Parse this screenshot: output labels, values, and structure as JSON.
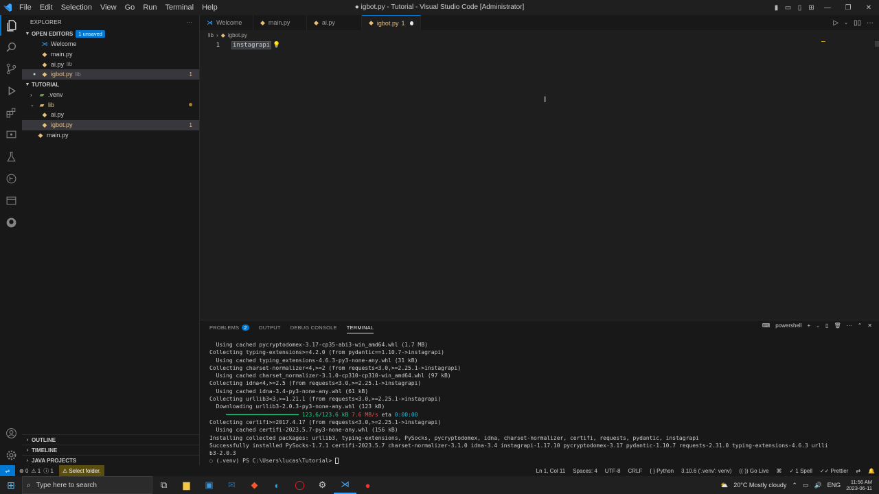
{
  "window": {
    "title": "● igbot.py - Tutorial - Visual Studio Code [Administrator]"
  },
  "menu": [
    "File",
    "Edit",
    "Selection",
    "View",
    "Go",
    "Run",
    "Terminal",
    "Help"
  ],
  "sidebar": {
    "title": "EXPLORER",
    "open_editors": {
      "label": "OPEN EDITORS",
      "badge": "1 unsaved",
      "items": [
        {
          "name": "Welcome",
          "hint": ""
        },
        {
          "name": "main.py",
          "hint": ""
        },
        {
          "name": "ai.py",
          "hint": "lib"
        },
        {
          "name": "igbot.py",
          "hint": "lib",
          "count": "1"
        }
      ]
    },
    "folder": {
      "label": "TUTORIAL",
      "items": [
        {
          "name": ".venv"
        },
        {
          "name": "lib"
        },
        {
          "name": "ai.py"
        },
        {
          "name": "igbot.py",
          "count": "1"
        },
        {
          "name": "main.py"
        }
      ]
    },
    "bottom": [
      "OUTLINE",
      "TIMELINE",
      "JAVA PROJECTS"
    ]
  },
  "tabs": [
    {
      "label": "Welcome"
    },
    {
      "label": "main.py"
    },
    {
      "label": "ai.py"
    },
    {
      "label": "igbot.py",
      "count": "1"
    }
  ],
  "breadcrumb": [
    "lib",
    "igbot.py"
  ],
  "editor": {
    "line_number": "1",
    "code": "instagrapi"
  },
  "panel": {
    "tabs": [
      "PROBLEMS",
      "OUTPUT",
      "DEBUG CONSOLE",
      "TERMINAL"
    ],
    "problems_count": "2",
    "shell": "powershell",
    "terminal_lines": [
      "  Using cached pycryptodomex-3.17-cp35-abi3-win_amd64.whl (1.7 MB)",
      "Collecting typing-extensions>=4.2.0 (from pydantic==1.10.7->instagrapi)",
      "  Using cached typing_extensions-4.6.3-py3-none-any.whl (31 kB)",
      "Collecting charset-normalizer<4,>=2 (from requests<3.0,>=2.25.1->instagrapi)",
      "  Using cached charset_normalizer-3.1.0-cp310-cp310-win_amd64.whl (97 kB)",
      "Collecting idna<4,>=2.5 (from requests<3.0,>=2.25.1->instagrapi)",
      "  Using cached idna-3.4-py3-none-any.whl (61 kB)",
      "Collecting urllib3<3,>=1.21.1 (from requests<3.0,>=2.25.1->instagrapi)",
      "  Downloading urllib3-2.0.3-py3-none-any.whl (123 kB)"
    ],
    "progress": {
      "bar": "     ━━━━━━━━━━━━━━━━━━━━━━ ",
      "size": "123.6/123.6 kB",
      "speed": "7.6 MB/s",
      "eta_label": "eta",
      "eta": "0:00:00"
    },
    "terminal_lines_after": [
      "Collecting certifi>=2017.4.17 (from requests<3.0,>=2.25.1->instagrapi)",
      "  Using cached certifi-2023.5.7-py3-none-any.whl (156 kB)",
      "Installing collected packages: urllib3, typing-extensions, PySocks, pycryptodomex, idna, charset-normalizer, certifi, requests, pydantic, instagrapi",
      "Successfully installed PySocks-1.7.1 certifi-2023.5.7 charset-normalizer-3.1.0 idna-3.4 instagrapi-1.17.10 pycryptodomex-3.17 pydantic-1.10.7 requests-2.31.0 typing-extensions-4.6.3 urlli",
      "b3-2.0.3"
    ],
    "prompt": "(.venv) PS C:\\Users\\lucas\\Tutorial> "
  },
  "status": {
    "errors": "0",
    "warnings": "1",
    "info": "1",
    "select_folder": "Select folder.",
    "position": "Ln 1, Col 11",
    "spaces": "Spaces: 4",
    "encoding": "UTF-8",
    "eol": "CRLF",
    "language": "Python",
    "interpreter": "3.10.6 ('.venv': venv)",
    "golive": "Go Live",
    "spell": "1 Spell",
    "prettier": "Prettier"
  },
  "taskbar": {
    "search_placeholder": "Type here to search",
    "weather": "20°C  Mostly cloudy",
    "lang": "ENG",
    "time": "11:56 AM",
    "date": "2023-06-11"
  },
  "colors": {
    "accent": "#0078d4",
    "modified": "#e2c08d"
  }
}
